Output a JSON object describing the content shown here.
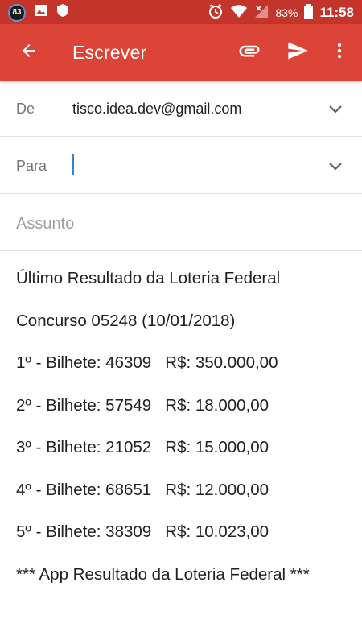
{
  "status_bar": {
    "badge": "83",
    "battery": "83%",
    "time": "11:58"
  },
  "app_bar": {
    "title": "Escrever",
    "icons": [
      "arrow-back-icon",
      "paperclip-icon",
      "send-icon",
      "more-vert-icon"
    ]
  },
  "from": {
    "label": "De",
    "value": "tisco.idea.dev@gmail.com"
  },
  "to": {
    "label": "Para",
    "value": ""
  },
  "subject": {
    "placeholder": "Assunto"
  },
  "body": {
    "lines": [
      "Último Resultado da Loteria Federal",
      "Concurso 05248 (10/01/2018)",
      "1º - Bilhete: 46309   R$: 350.000,00",
      "2º - Bilhete: 57549   R$: 18.000,00",
      "3º - Bilhete: 21052   R$: 15.000,00",
      "4º - Bilhete: 68651   R$: 12.000,00",
      "5º - Bilhete: 38309   R$: 10.023,00",
      "*** App Resultado da Loteria Federal ***"
    ]
  },
  "colors": {
    "app_bar": "#db4437",
    "status_bar": "#c3342a",
    "cursor": "#3c7dd6"
  }
}
